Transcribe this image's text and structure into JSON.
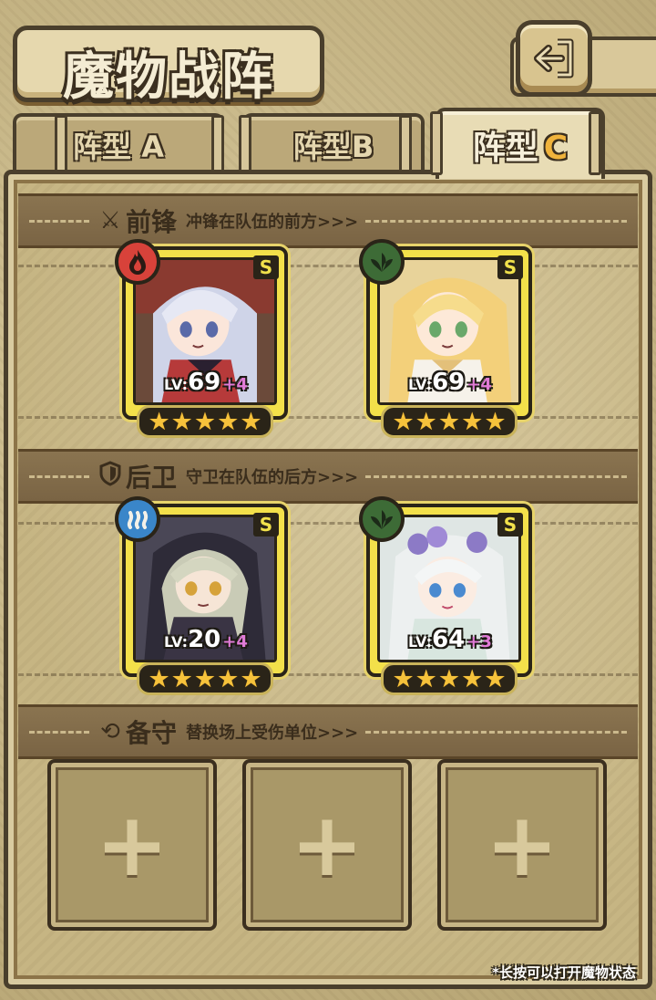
{
  "header": {
    "title": "魔物战阵",
    "back_icon": "return-arrow-icon"
  },
  "tabs": [
    {
      "label": "阵型",
      "letter": "A",
      "selected": false
    },
    {
      "label": "阵型",
      "letter": "B",
      "selected": false
    },
    {
      "label": "阵型",
      "letter": "C",
      "selected": true
    }
  ],
  "sections": {
    "front": {
      "icon": "sword-icon",
      "title": "前锋",
      "desc": "冲锋在队伍的前方>>>"
    },
    "back": {
      "icon": "shield-icon",
      "title": "后卫",
      "desc": "守卫在队伍的后方>>>"
    },
    "reserve": {
      "icon": "swap-icon",
      "title": "备守",
      "desc": "替换场上受伤单位>>>"
    }
  },
  "front_units": [
    {
      "element": "fire",
      "element_color": "#d8423a",
      "rarity": "S",
      "lv_label": "LV:",
      "level": "69",
      "bonus": "+4",
      "stars": 5
    },
    {
      "element": "nature",
      "element_color": "#3d6b36",
      "rarity": "S",
      "lv_label": "LV:",
      "level": "69",
      "bonus": "+4",
      "stars": 5
    }
  ],
  "back_units": [
    {
      "element": "water",
      "element_color": "#3a86c9",
      "rarity": "S",
      "lv_label": "LV:",
      "level": "20",
      "bonus": "+4",
      "stars": 5
    },
    {
      "element": "nature",
      "element_color": "#3d6b36",
      "rarity": "S",
      "lv_label": "LV:",
      "level": "64",
      "bonus": "+3",
      "stars": 5
    }
  ],
  "reserve_slots": [
    {
      "symbol": "+"
    },
    {
      "symbol": "+"
    },
    {
      "symbol": "+"
    }
  ],
  "footer_note": "*长按可以打开魔物状态"
}
